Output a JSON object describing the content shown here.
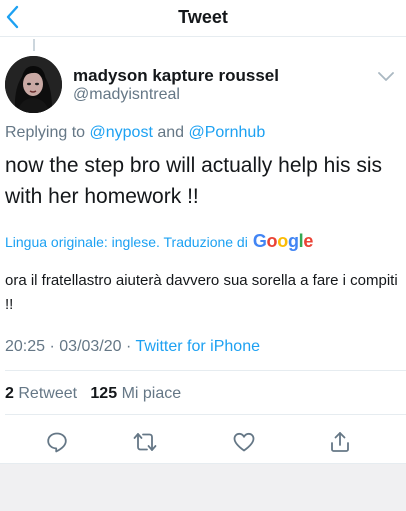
{
  "navbar": {
    "title": "Tweet"
  },
  "author": {
    "name": "madyson kapture roussel",
    "handle": "@madyisntreal"
  },
  "reply": {
    "prefix": "Replying to ",
    "mention1": "@nypost",
    "connector": " and ",
    "mention2": "@Pornhub"
  },
  "tweet": {
    "text": "now the step bro will actually help his sis with her homework !!"
  },
  "translation": {
    "label": "Lingua originale: inglese. Traduzione di",
    "provider": "Google",
    "text": "ora il fratellastro aiuterà davvero sua sorella a fare i compiti !!"
  },
  "meta": {
    "time": "20:25",
    "separator1": " · ",
    "date": "03/03/20",
    "separator2": " · ",
    "source": "Twitter for iPhone"
  },
  "stats": {
    "retweets_count": "2",
    "retweets_label": "Retweet",
    "likes_count": "125",
    "likes_label": "Mi piace"
  },
  "icons": {
    "back": "chevron-left-icon",
    "caret": "chevron-down-icon",
    "reply": "reply-icon",
    "retweet": "retweet-icon",
    "like": "heart-icon",
    "share": "share-icon"
  },
  "colors": {
    "accent": "#1da1f2",
    "text": "#14171a",
    "secondary": "#657786",
    "divider": "#e6ecf0"
  }
}
